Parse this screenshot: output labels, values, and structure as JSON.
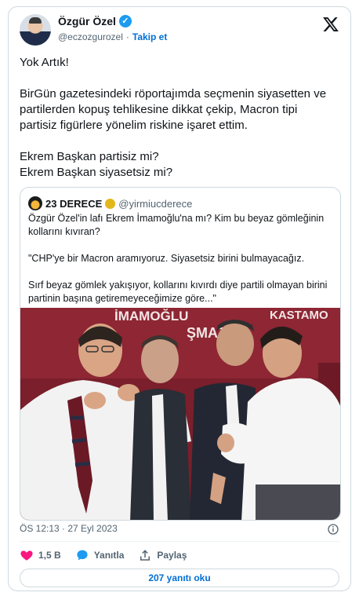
{
  "author": {
    "name": "Özgür Özel",
    "handle": "@eczozgurozel",
    "separator": "·",
    "follow_label": "Takip et"
  },
  "tweet": {
    "text": "Yok Artık!\n\nBirGün gazetesindeki röportajımda seçmenin siyasetten ve partilerden kopuş tehlikesine dikkat çekip, Macron tipi partisiz figürlere yönelim riskine işaret ettim.\n\nEkrem Başkan partisiz mi?\nEkrem Başkan siyasetsiz mi?",
    "timestamp": "ÖS 12:13 · 27 Eyl 2023"
  },
  "quote": {
    "name": "23 DERECE",
    "handle": "@yirmiucderece",
    "text": "Özgür Özel'in lafı Ekrem İmamoğlu'na mı? Kim bu beyaz gömleğinin kollarını kıvıran?\n\n\"CHP'ye bir Macron aramıyoruz. Siyasetsiz birini bulmayacağız.\n\nSırf beyaz gömlek yakışıyor, kollarını kıvırdı diye partili olmayan birini partinin başına getiremeyeceğimize göre...\"",
    "photo_text": {
      "banner_left": "İMAMOĞLU",
      "banner_right_top": "KASTAMO",
      "banner_right_bottom": "ŞMAZ"
    }
  },
  "actions": {
    "likes": "1,5 B",
    "reply_label": "Yanıtla",
    "share_label": "Paylaş"
  },
  "read_replies_label": "207 yanıtı oku",
  "colors": {
    "accent": "#1d9bf0",
    "link": "#006fd6",
    "like": "#f91880",
    "muted": "#536471"
  }
}
